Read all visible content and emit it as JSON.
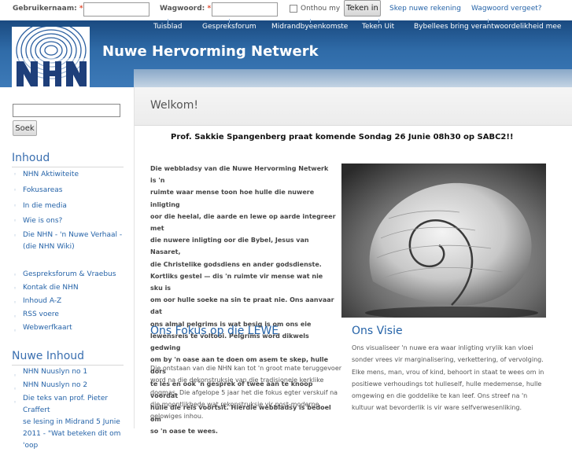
{
  "topbar": {
    "username_label": "Gebruikernaam:",
    "password_label": "Wagwoord:",
    "required_mark": "*",
    "remember_label": "Onthou my",
    "login_button": "Teken in",
    "register_link": "Skep nuwe rekening",
    "forgot_link": "Wagwoord vergeet?"
  },
  "header": {
    "site_name": "Nuwe Hervorming Netwerk",
    "logo_text": "NHN",
    "nav": [
      "Tuisblad",
      "Gespreksforum",
      "Midrandbyeenkomste",
      "Teken Uit",
      "Bybellees bring verantwoordelikheid mee"
    ]
  },
  "sidebar": {
    "search_button": "Soek",
    "section1_title": "Inhoud",
    "section1_items": [
      "NHN Aktiwiteite",
      "Fokusareas",
      "In die media",
      "Wie is ons?",
      "Die NHN - 'n Nuwe Verhaal -",
      "(die NHN Wiki)"
    ],
    "section1_items2": [
      "Gespreksforum & Vraebus",
      "Kontak die NHN",
      "Inhoud A-Z",
      "RSS voere",
      "Webwerfkaart"
    ],
    "section2_title": "Nuwe Inhoud",
    "section2_items": [
      "NHN Nuuslyn no 1",
      "NHN Nuuslyn no 2",
      "Die teks van prof. Pieter Craffert",
      "se lesing in Midrand 5 Junie",
      "2011 - \"Wat beteken dit om 'oop"
    ]
  },
  "main": {
    "welcome": "Welkom!",
    "announcement": "Prof. Sakkie Spangenberg praat komende Sondag 26 Junie 08h30 op SABC2!!",
    "intro_lines": [
      "Die webbladsy van die Nuwe Hervorming Netwerk is 'n",
      "ruimte waar mense toon hoe hulle die nuwere inligting",
      "oor die heelal, die aarde en lewe op aarde integreer met",
      "die nuwere inligting oor die Bybel, Jesus van Nasaret,",
      "die Christelike godsdiens en ander godsdienste.",
      "Kortliks gestel — dis 'n ruimte vir mense wat nie sku is",
      "om oor hulle soeke na sin te praat nie. Ons aanvaar dat",
      "ons almal pelgrims is wat besig is om ons eie",
      "lewensreis te voltooi. Pelgrims word dikwels gedwing",
      "om by 'n oase aan te doen om asem te skep, hulle dors",
      "te les en ook 'n gesprek of twee aan te knoop voordat",
      "hulle die reis voortsit. Hierdie webbladsy is bedoel om",
      "so 'n oase te wees."
    ],
    "focus_title": "Ons Fokus op die LEWE",
    "focus_lines": [
      "Die ontstaan van die NHN kan tot 'n groot mate teruggevoer",
      "word na die dekonstruksie van die tradisionele kerklike",
      "dogmas. Die afgelope 5 jaar het die fokus egter verskuif na",
      "die moontlikhede wat rekonstruksie vir post-moderne",
      "gelowiges inhou."
    ],
    "vision_title": "Ons Visie",
    "vision_lines": [
      "Ons visualiseer 'n nuwe era waar inligting vrylik kan vloei",
      "sonder vrees vir marginalisering, verkettering, of vervolging.",
      "Elke mens, man, vrou of kind, behoort in staat te wees om in",
      "positiewe verhoudings tot hulleself, hulle medemense, hulle",
      "omgewing en die goddelike te kan leef. Ons streef na 'n",
      "kultuur wat bevorderlik is vir ware selfverwesenliking."
    ]
  },
  "colors": {
    "link": "#2563a8",
    "header_dark": "#1a4a80",
    "header_light": "#3d7ab8",
    "required": "#e04a2f"
  }
}
